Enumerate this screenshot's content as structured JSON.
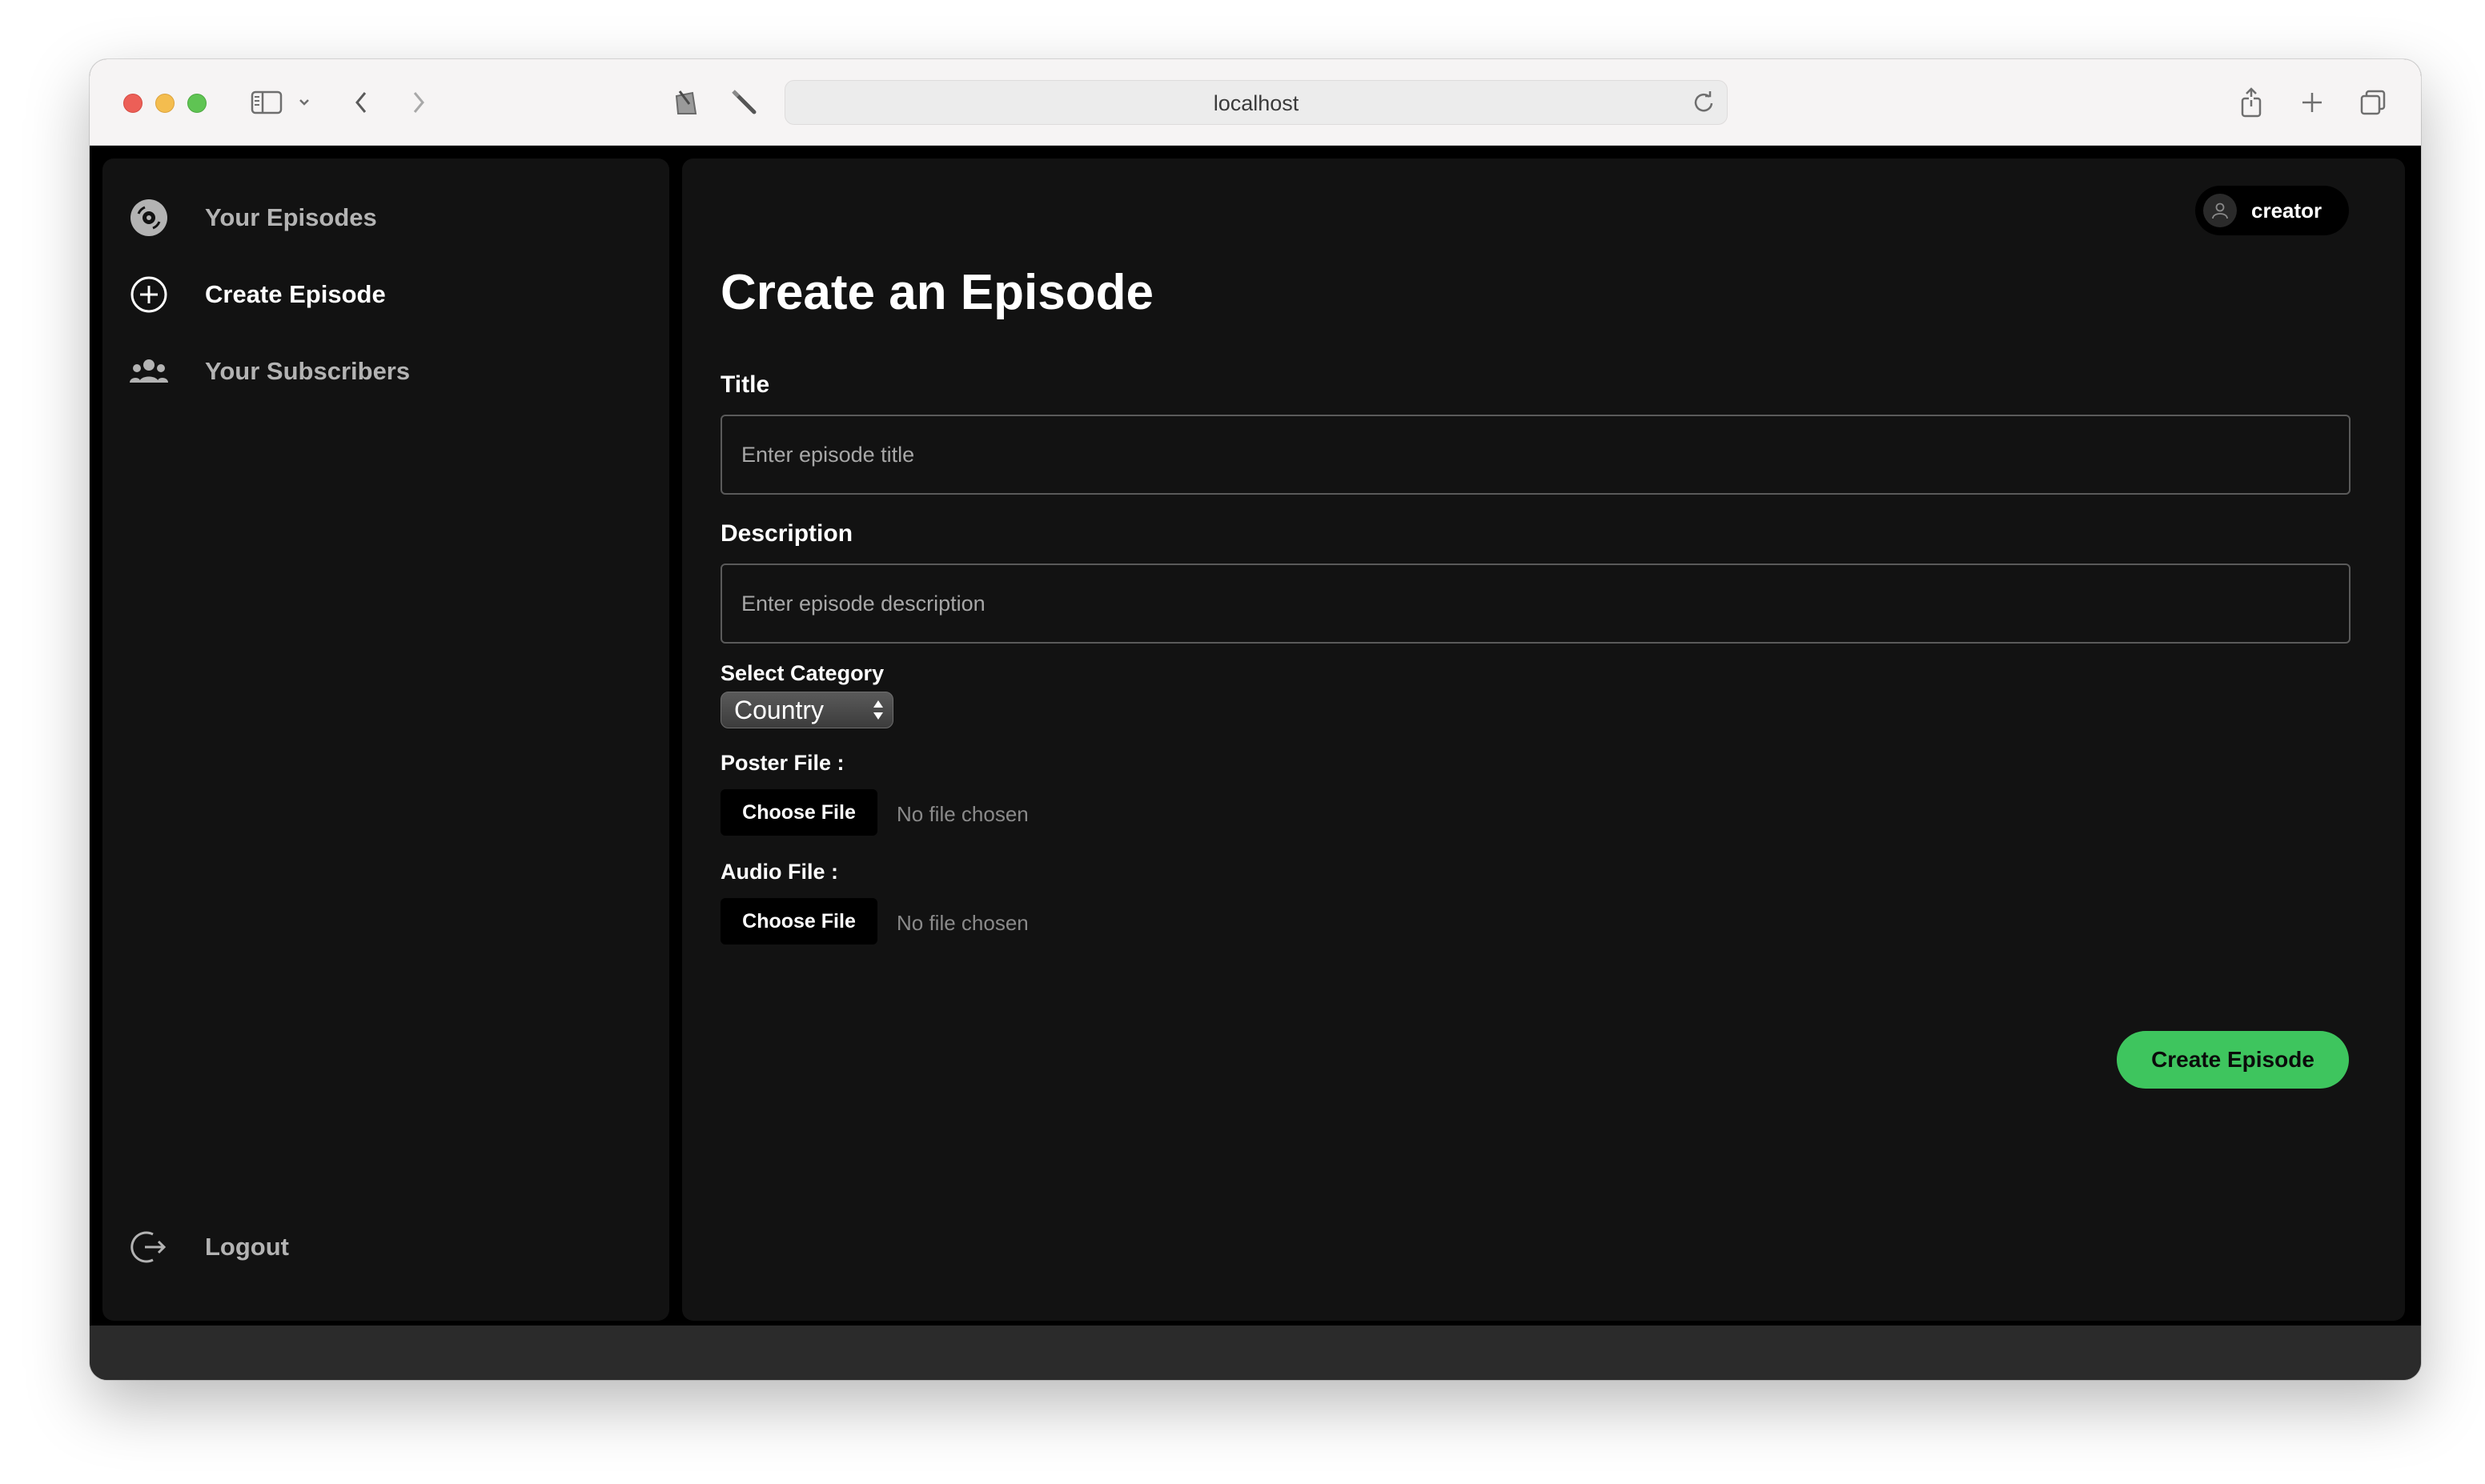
{
  "browser": {
    "url": "localhost"
  },
  "sidebar": {
    "items": [
      {
        "label": "Your Episodes",
        "icon": "disc-icon",
        "active": false
      },
      {
        "label": "Create Episode",
        "icon": "plus-circle-icon",
        "active": true
      },
      {
        "label": "Your Subscribers",
        "icon": "users-icon",
        "active": false
      }
    ],
    "logout_label": "Logout"
  },
  "header": {
    "username": "creator"
  },
  "form": {
    "title": "Create an Episode",
    "title_label": "Title",
    "title_placeholder": "Enter episode title",
    "description_label": "Description",
    "description_placeholder": "Enter episode description",
    "category_label": "Select Category",
    "category_selected": "Country",
    "poster_label": "Poster File :",
    "audio_label": "Audio File :",
    "choose_file_label": "Choose File",
    "no_file_text": "No file chosen",
    "submit_label": "Create Episode"
  },
  "colors": {
    "accent": "#3ec55e",
    "background": "#000000",
    "panel": "#121212"
  }
}
